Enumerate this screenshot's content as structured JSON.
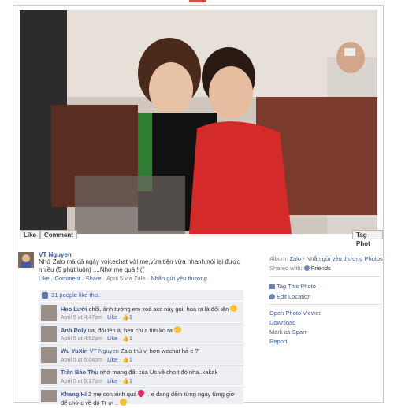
{
  "photo": {
    "like_label": "Like",
    "comment_label": "Comment",
    "tag_label": "Tag Phot"
  },
  "post": {
    "author": "VT Nguyen",
    "caption": "Nhớ Zalo mà cả ngày voicechat với mẹ,vừa tiện vừa nhanh,nói lại được nhiều (5 phút luôn) ....Nhớ mẹ quá !:((",
    "actions": {
      "like": "Like",
      "comment": "Comment",
      "share": "Share",
      "timestamp": "April 5 via Zalo",
      "album_link": "Nhắn gửi yêu thương"
    },
    "likes_text": "31 people like this."
  },
  "comments": [
    {
      "name": "Heo Lười",
      "text": "chồi, ảnh tướng em xoá acc này gòi, hoá ra là đổi tên",
      "emoticon": "smile",
      "time": "April 5 at 4:47pm",
      "like": "Like",
      "likes": "1"
    },
    {
      "name": "Anh Poly",
      "text": "ủa, đổi tên à, hèn chi a tìm ko ra",
      "emoticon": "smile",
      "time": "April 5 at 4:52pm",
      "like": "Like",
      "likes": "1"
    },
    {
      "name": "Wu YuXin",
      "mention": "VT Nguyen",
      "text": "Zalo thú vị hơn wechat hả e ?",
      "time": "April 5 at 5:04pm",
      "like": "Like",
      "likes": "1"
    },
    {
      "name": "Trần Bảo Thu",
      "text": "nhớ mang đất của Us về cho t đó nha..kakak",
      "time": "April 5 at 5:17pm",
      "like": "Like",
      "likes": "1"
    },
    {
      "name": "Khang Hí",
      "text_before": "2 mẹ con xinh quá",
      "text_after": ".. e đang đếm từng ngày từng giờ để chờ c về đó Tr ơi ..",
      "emoticon": "smile"
    }
  ],
  "sidebar": {
    "album_label": "Album:",
    "album_value": "Zalo - Nhắn gửi yêu thương Photos",
    "shared_label": "Shared with:",
    "shared_value": "Friends",
    "tag_photo": "Tag This Photo",
    "edit_location": "Edit Location",
    "open_viewer": "Open Photo Viewer",
    "download": "Download",
    "mark_spam": "Mark as Spam",
    "report": "Report"
  },
  "colors": {
    "link": "#3b5998",
    "comment_bg": "#edeff4",
    "dress_red": "#d42a2a"
  }
}
